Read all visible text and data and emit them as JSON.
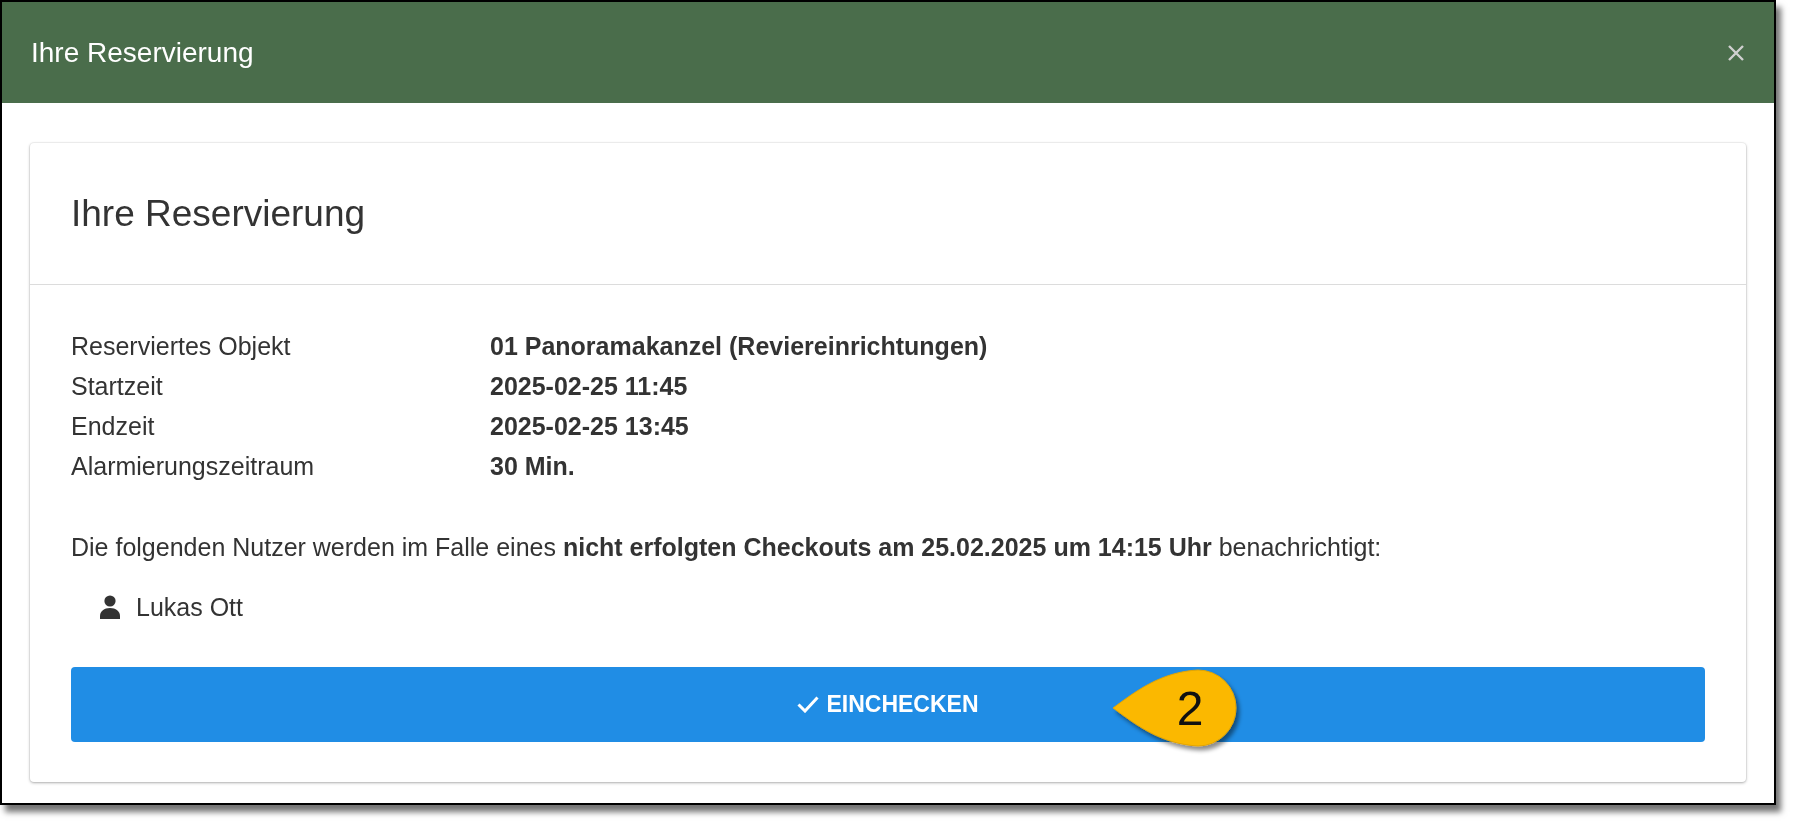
{
  "dialog": {
    "title": "Ihre Reservierung"
  },
  "card": {
    "title": "Ihre Reservierung",
    "details": [
      {
        "label": "Reserviertes Objekt",
        "value": "01 Panoramakanzel (Reviereinrichtungen)"
      },
      {
        "label": "Startzeit",
        "value": "2025-02-25 11:45"
      },
      {
        "label": "Endzeit",
        "value": "2025-02-25 13:45"
      },
      {
        "label": "Alarmierungszeitraum",
        "value": "30 Min."
      }
    ],
    "notice": "Die folgenden Nutzer werden im Falle eines **nicht erfolgten Checkouts am 25.02.2025 um 14:15 Uhr** benachrichtigt:",
    "users": [
      {
        "name": "Lukas Ott"
      }
    ],
    "button": {
      "label": "EINCHECKEN"
    }
  },
  "callout": {
    "label": "2"
  }
}
